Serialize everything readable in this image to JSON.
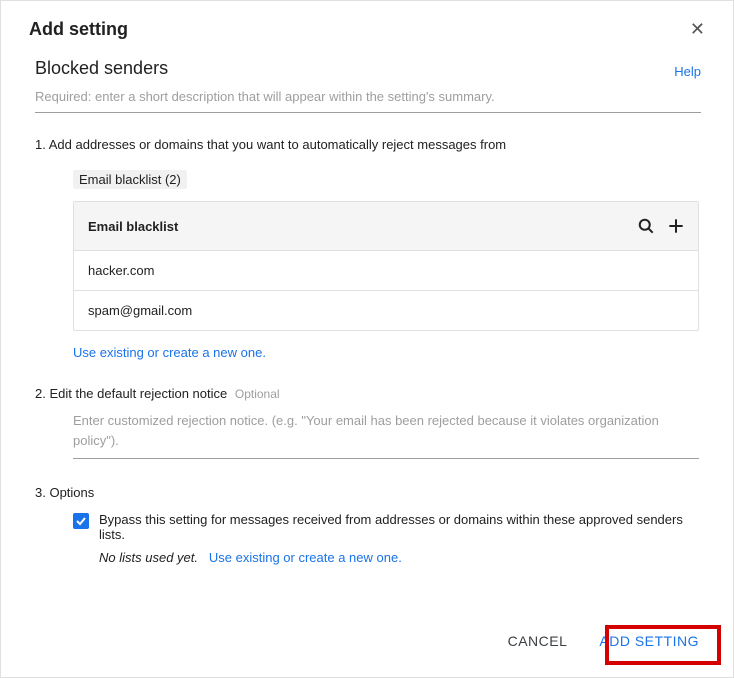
{
  "dialog": {
    "title": "Add setting",
    "subtitle": "Blocked senders",
    "help": "Help",
    "description_placeholder": "Required: enter a short description that will appear within the setting's summary."
  },
  "step1": {
    "label": "1. Add addresses or domains that you want to automatically reject messages from",
    "pill": "Email blacklist (2)",
    "table_title": "Email blacklist",
    "rows": [
      "hacker.com",
      "spam@gmail.com"
    ],
    "use_existing": "Use existing or create a new one."
  },
  "step2": {
    "label": "2. Edit the default rejection notice",
    "optional": "Optional",
    "placeholder": "Enter customized rejection notice. (e.g. \"Your email has been rejected because it violates organization policy\")."
  },
  "step3": {
    "label": "3. Options",
    "checkbox_label": "Bypass this setting for messages received from addresses or domains within these approved senders lists.",
    "no_lists": "No lists used yet.",
    "use_existing": "Use existing or create a new one."
  },
  "footer": {
    "cancel": "CANCEL",
    "add": "ADD SETTING"
  }
}
